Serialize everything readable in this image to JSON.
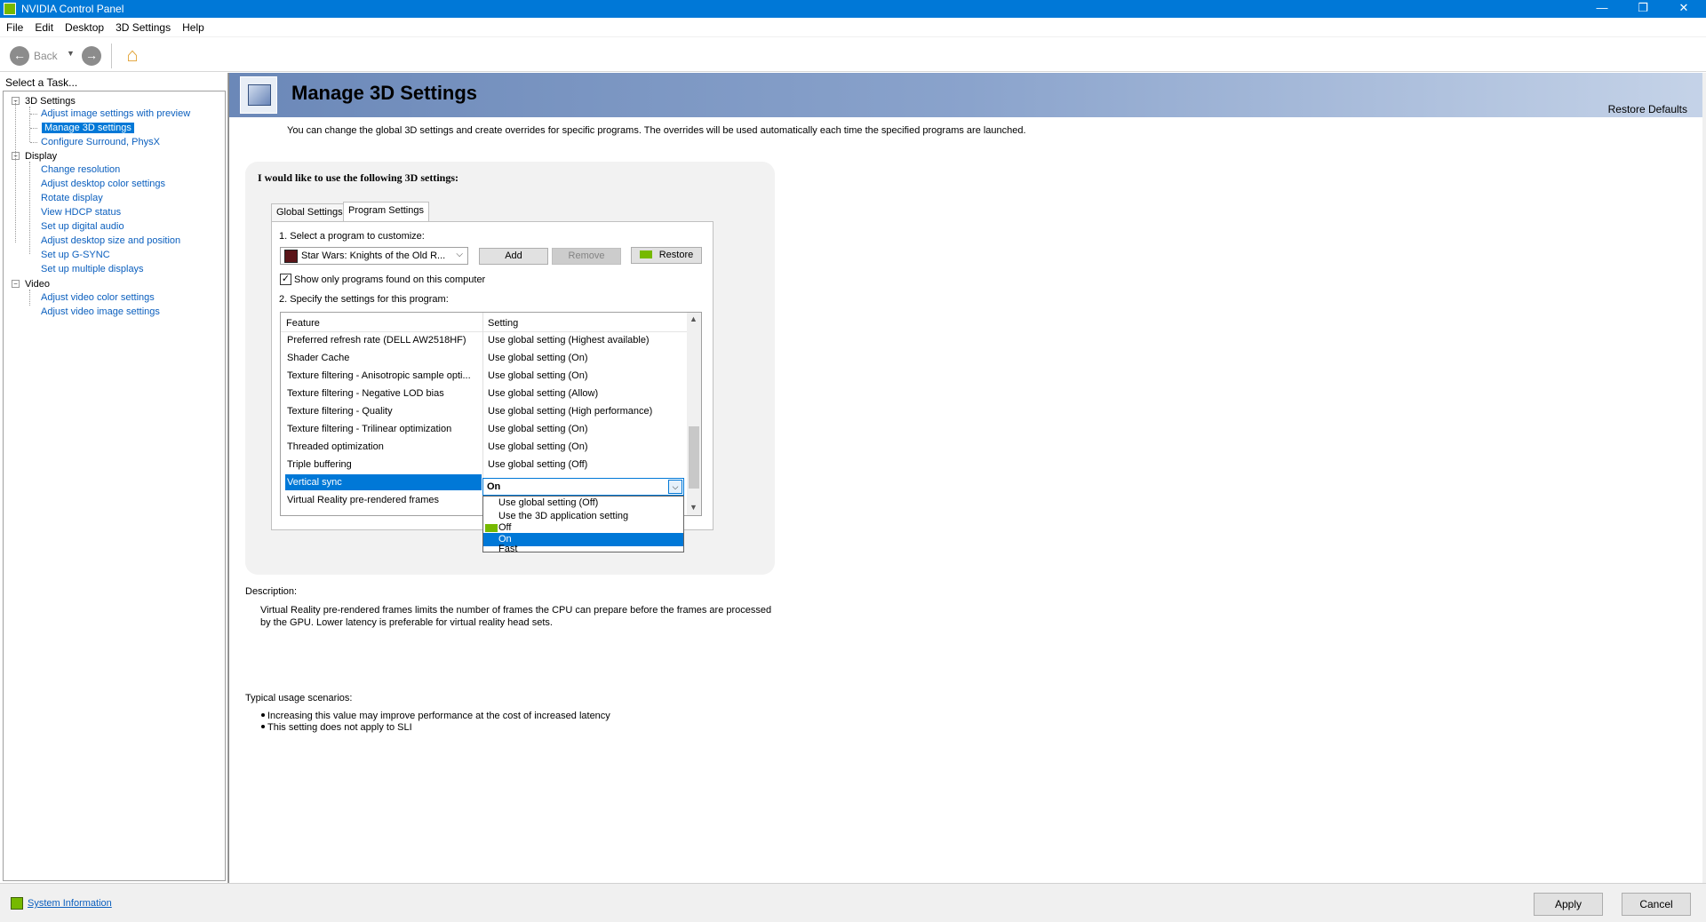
{
  "window": {
    "title": "NVIDIA Control Panel",
    "minimize": "—",
    "maximize": "❐",
    "close": "✕"
  },
  "menu": [
    "File",
    "Edit",
    "Desktop",
    "3D Settings",
    "Help"
  ],
  "toolbar": {
    "back_label": "Back"
  },
  "tasks": {
    "header": "Select a Task...",
    "groups": [
      {
        "label": "3D Settings",
        "items": [
          "Adjust image settings with preview",
          "Manage 3D settings",
          "Configure Surround, PhysX"
        ]
      },
      {
        "label": "Display",
        "items": [
          "Change resolution",
          "Adjust desktop color settings",
          "Rotate display",
          "View HDCP status",
          "Set up digital audio",
          "Adjust desktop size and position",
          "Set up G-SYNC",
          "Set up multiple displays"
        ]
      },
      {
        "label": "Video",
        "items": [
          "Adjust video color settings",
          "Adjust video image settings"
        ]
      }
    ],
    "selected": "Manage 3D settings"
  },
  "page": {
    "title": "Manage 3D Settings",
    "restore_defaults": "Restore Defaults",
    "intro": "You can change the global 3D settings and create overrides for specific programs. The overrides will be used automatically each time the specified programs are launched.",
    "heading": "I would like to use the following 3D settings:",
    "tabs": [
      "Global Settings",
      "Program Settings"
    ],
    "active_tab": "Program Settings",
    "step1": "1. Select a program to customize:",
    "program": "Star Wars: Knights of the Old R...",
    "add": "Add",
    "remove": "Remove",
    "restore": "Restore",
    "show_only": "Show only programs found on this computer",
    "show_only_checked": true,
    "step2": "2. Specify the settings for this program:",
    "grid": {
      "col_feature": "Feature",
      "col_setting": "Setting",
      "rows": [
        {
          "feature": "Preferred refresh rate (DELL AW2518HF)",
          "setting": "Use global setting (Highest available)"
        },
        {
          "feature": "Shader Cache",
          "setting": "Use global setting (On)"
        },
        {
          "feature": "Texture filtering - Anisotropic sample opti...",
          "setting": "Use global setting (On)"
        },
        {
          "feature": "Texture filtering - Negative LOD bias",
          "setting": "Use global setting (Allow)"
        },
        {
          "feature": "Texture filtering - Quality",
          "setting": "Use global setting (High performance)"
        },
        {
          "feature": "Texture filtering - Trilinear optimization",
          "setting": "Use global setting (On)"
        },
        {
          "feature": "Threaded optimization",
          "setting": "Use global setting (On)"
        },
        {
          "feature": "Triple buffering",
          "setting": "Use global setting (Off)"
        },
        {
          "feature": "Vertical sync",
          "setting": "On"
        },
        {
          "feature": "Virtual Reality pre-rendered frames",
          "setting": ""
        }
      ],
      "selected_row": "Vertical sync"
    },
    "dropdown": {
      "value": "On",
      "options": [
        "Use global setting (Off)",
        "Use the 3D application setting",
        "Off",
        "On",
        "Fast"
      ],
      "highlighted": "On"
    },
    "description_label": "Description:",
    "description": "Virtual Reality pre-rendered frames limits the number of frames the CPU can prepare before the frames are processed by the GPU. Lower latency is preferable for virtual reality head sets.",
    "usage_label": "Typical usage scenarios:",
    "usage": [
      "Increasing this value may improve performance at the cost of increased latency",
      "This setting does not apply to SLI"
    ]
  },
  "footer": {
    "system_info": "System Information",
    "apply": "Apply",
    "cancel": "Cancel"
  },
  "colors": {
    "titlebar": "#0078d7",
    "selection": "#0078d7",
    "nvidia_green": "#76b900",
    "link": "#0b5fbe"
  }
}
